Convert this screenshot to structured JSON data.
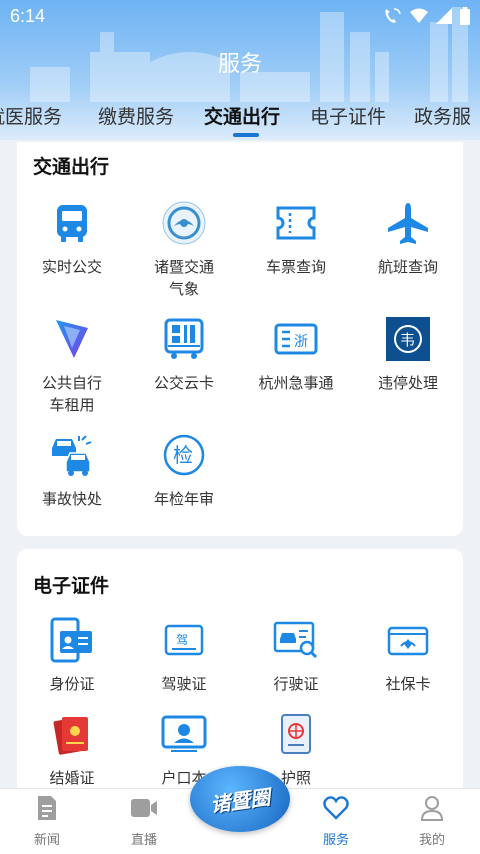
{
  "status": {
    "time": "6:14"
  },
  "page_title": "服务",
  "tabs": [
    "就医服务",
    "缴费服务",
    "交通出行",
    "电子证件",
    "政务服"
  ],
  "traffic": {
    "title": "交通出行",
    "items": [
      {
        "label": "实时公交",
        "icon": "bus-icon"
      },
      {
        "label": "诸暨交通\n气象",
        "icon": "weather-logo-icon"
      },
      {
        "label": "车票查询",
        "icon": "ticket-icon"
      },
      {
        "label": "航班查询",
        "icon": "airplane-icon"
      },
      {
        "label": "公共自行\n车租用",
        "icon": "bike-app-icon"
      },
      {
        "label": "公交云卡",
        "icon": "bus-card-icon"
      },
      {
        "label": "杭州急事通",
        "icon": "zhe-icon"
      },
      {
        "label": "违停处理",
        "icon": "parking-violation-icon"
      },
      {
        "label": "事故快处",
        "icon": "car-accident-icon"
      },
      {
        "label": "年检年审",
        "icon": "inspection-icon"
      }
    ]
  },
  "certs": {
    "title": "电子证件",
    "items": [
      {
        "label": "身份证",
        "icon": "id-card-icon"
      },
      {
        "label": "驾驶证",
        "icon": "driver-license-icon"
      },
      {
        "label": "行驶证",
        "icon": "vehicle-license-icon"
      },
      {
        "label": "社保卡",
        "icon": "social-security-icon"
      },
      {
        "label": "结婚证",
        "icon": "marriage-cert-icon"
      },
      {
        "label": "户口本",
        "icon": "household-register-icon"
      },
      {
        "label": "护照",
        "icon": "passport-icon"
      }
    ]
  },
  "nav": [
    {
      "label": "新闻",
      "icon": "news-icon"
    },
    {
      "label": "直播",
      "icon": "live-icon"
    },
    {
      "label": "服务",
      "icon": "heart-icon"
    },
    {
      "label": "我的",
      "icon": "profile-icon"
    }
  ],
  "center_badge": "诸暨圈",
  "colors": {
    "accent": "#1976d2",
    "icon_blue": "#1e88e5"
  }
}
